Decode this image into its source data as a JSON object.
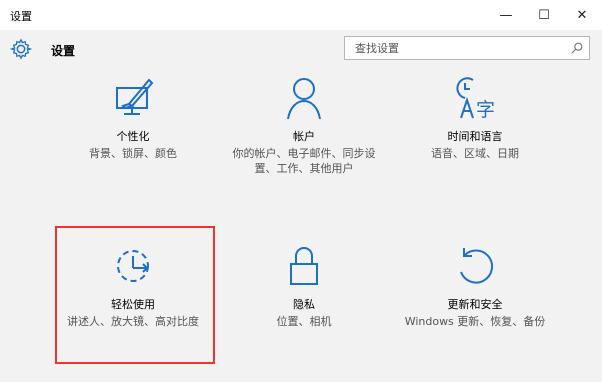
{
  "window": {
    "title": "设置"
  },
  "titlebar_controls": {
    "minimize": "—",
    "maximize": "☐",
    "close": "✕"
  },
  "header": {
    "app_title": "设置",
    "search_placeholder": "查找设置"
  },
  "accent_color": "#1e6fc8",
  "highlight_color": "#ee3333",
  "tiles": [
    {
      "name": "个性化",
      "desc": "背景、锁屏、颜色",
      "icon": "personalization-icon"
    },
    {
      "name": "帐户",
      "desc": "你的帐户、电子邮件、同步设置、工作、其他用户",
      "icon": "accounts-icon"
    },
    {
      "name": "时间和语言",
      "desc": "语音、区域、日期",
      "icon": "time-language-icon"
    },
    {
      "name": "轻松使用",
      "desc": "讲述人、放大镜、高对比度",
      "icon": "ease-of-access-icon"
    },
    {
      "name": "隐私",
      "desc": "位置、相机",
      "icon": "privacy-lock-icon"
    },
    {
      "name": "更新和安全",
      "desc": "Windows 更新、恢复、备份",
      "icon": "update-security-icon"
    }
  ]
}
